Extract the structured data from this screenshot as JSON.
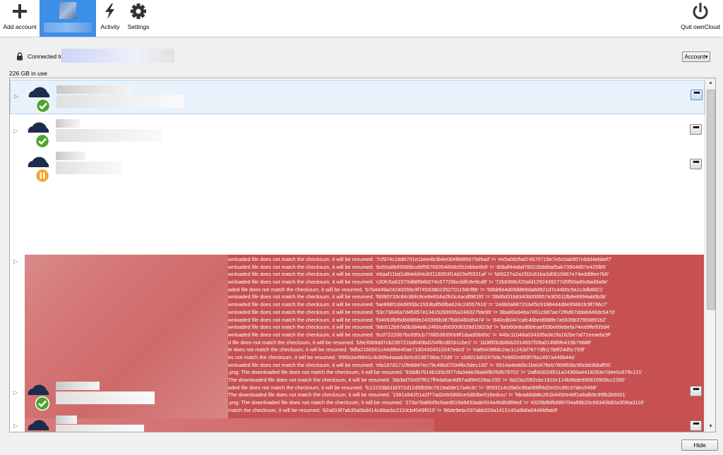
{
  "toolbar": {
    "add_account": "Add account",
    "activity": "Activity",
    "settings": "Settings",
    "quit": "Quit ownCloud"
  },
  "account": {
    "connected_label": "Connected to",
    "account_button": "Account",
    "usage": "226 GB in use"
  },
  "folders": [
    {
      "status": "ok",
      "selected": true
    },
    {
      "status": "ok",
      "selected": false
    },
    {
      "status": "paused",
      "selected": false
    },
    {
      "status": "ok",
      "selected": false
    },
    {
      "status": "ok",
      "selected": false
    }
  ],
  "error_lines": [
    "wnloaded file does not match the checksum, it will be resumed. '7cf974c18d6701e1bee4b3b4e064f8985679d9ad' != 'ee5a082fad74670719e7e5c0ab907c6dd4ebbef7'",
    "wnloaded file does not match the checksum, it will be resumed. '6c65a8b85589bcd9f5676935480dc552ebbe0b9' != 'd0bdf44afaf78022b9d0af5ab73904d57e425f85'",
    "wnloaded file does not match the checksum, it will be resumed. 'e6aaf11bd1d84eb64c83118353f14d15ef5521af' != 'b69227a2a1f02c61ba3d0615667e74eddf8ee7b6'",
    "wnloaded file does not match the checksum, it will be resumed. 'c30fc5a61570d88f94b074c67728bcddfc8e9cd8' != '72b8368cf20afd1292439277d5f50ad0c8ad3a9e'",
    "aded file does not match the checksum, it will be resumed. 'b7b4449a24240059c9f74593802352701158cf8b' != '56bb5e4d068889da8d921d7c44b5c9a1c3db8821'",
    "wnloaded file does not match the checksum, it will be resumed. 'f9390733c84c8bfc9ce8e834a2fc0c4acdf961f0' != '08d6d31b8340b000657e3f2611fb8e8994ab0b3b'",
    "wnloaded file does not match the checksum, it will be resumed. 'fae868f1d4d955bc1553bdf56fba624c24557616' != '2e6b0a887203ef5c9198444d8e95881fc9f796c7'",
    "wnloaded file does not match the checksum, it will be resumed. '53c73846a7d45357e13415269935a248327fde99' != '8ba80a94ba7451c9d7ae72f6d67dda6d46dc547d'",
    "wnloaded file does not match the checksum, it will be resumed. 'f34063fbf6d66f86fe243399b387fb83460d5474' != '840cdb047cafc46bed698fe7a5535b37959891b2'",
    "wnloaded file does not match the checksum, it will be resumed. '9dc612b97a0b384e8c2460cd563008328d15623d' != 'beb60e8cd6bfcaef330e69ebefa74ea5ffe935d4'",
    "wnloaded file does not match the checksum, it will be resumed. '6cd72220b7bc695cb7768538390e8f1daa95b60c' != '445c11048a034335a3e2fa162be7af71eeaebc9f'",
    "d file does not match the checksum, it will be resumed. 'b9e35b9dd7cb236721bd040bd154f6cd61b1cbe1' != '1b38f2b3b6bb2014937f28a014fd6fe419b79888'",
    "le does not match the checksum, it will be resumed. '9dfa2166501c44d9be40ae71804304510247edc0' != 'ea854388dc2ac1c243d7877dfb17b9f24d5c793f'",
    "es not match the checksum, it will be resumed. '896b3a49941c4c80fa4aaab3e0c8198738ac72d9' != 'cb8013d0247b9c7e66f2e859f79a1497a446b44a'",
    "wnloaded file does not match the checksum, it will be resumed. 'efa187d1710feb847ec79c46bd7034fbc5dec192' != '6614a4edd5c1be0478eb780860bc95cbb3bbdf55'",
    ".png: The downloaded file does not match the checksum, it will be resumed. '93ddb7614b193c5f77da34de28ad4f826d978701' != '2afb6302d511a24309a4418293e7d4e0c679c121'",
    "The downloaded file does not match the checksum, it will be resumed. '3dcbd70c0f7f617ff4da6ac4d97ad5fe028ac155' != 'da23a2062cbc1910c124b96de956816909cc2285'",
    "aded file does not match the checksum, it will be resumed. 'fc12153bb1bf372d12d5fb59c7919a0de17a4e3c' != '3593114c0fa0cd9a068ff4d2e02cd9c37dec5468'",
    "The downloaded file does not match the checksum, it will be resumed. '1581a94251a2f77ad2eb0d66ce0d83be516edccc' != 'fdeaddab8c261b4450e48f1a6afb9c99fb2b5001'",
    ".png: The downloaded file does not match the checksum, it will be resumed. '273a76a6645c6aed019a9d33ade504a46d0d89ed' != '4329b8bfb689704a96b20c66340b82a3f36a3118'",
    "match the checksum, it will be resumed. '62a919f7ab35a5bd414c88acbc2110cb4549f010' != '86de9ebc037abb326a1415145a8b6a0446fdfab9'"
  ],
  "buttons": {
    "hide": "Hide",
    "more": "•••"
  },
  "colors": {
    "accent": "#3b8fe6",
    "ok": "#4ca62d",
    "paused": "#f5a623",
    "error": "#c75050"
  },
  "icons": {
    "add": "plus-icon",
    "activity": "lightning-icon",
    "settings": "gear-icon",
    "quit": "power-icon",
    "lock": "lock-icon"
  }
}
